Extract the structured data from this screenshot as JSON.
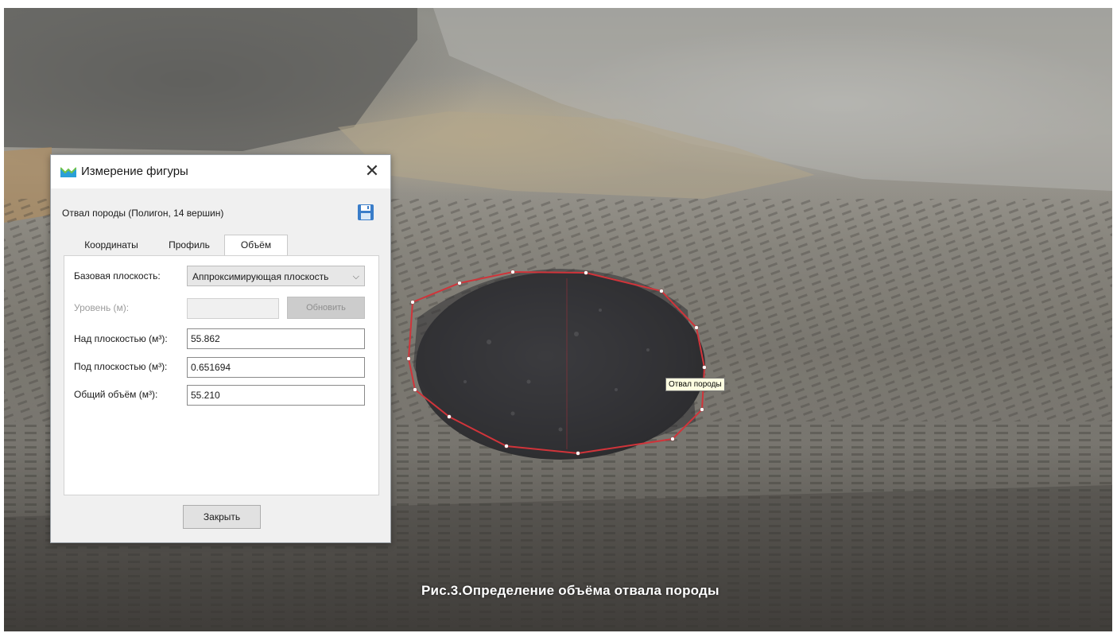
{
  "dialog": {
    "title": "Измерение фигуры",
    "layer_name": "Отвал породы (Полигон, 14 вершин)",
    "tabs": [
      {
        "label": "Координаты"
      },
      {
        "label": "Профиль"
      },
      {
        "label": "Объём"
      }
    ],
    "active_tab": "Объём",
    "base_plane_label": "Базовая плоскость:",
    "base_plane_value": "Аппроксимирующая плоскость",
    "level_label": "Уровень (м):",
    "level_value": "",
    "refresh_label": "Обновить",
    "above_label": "Над плоскостью (м³):",
    "above_value": "55.862",
    "below_label": "Под плоскостью (м³):",
    "below_value": "0.651694",
    "total_label": "Общий объём (м³):",
    "total_value": "55.210",
    "close_label": "Закрыть"
  },
  "map": {
    "tooltip": "Отвал породы",
    "polygon_color": "#d0343a",
    "vertex_color": "#ffffff"
  },
  "caption": "Рис.3.Определение объёма отвала породы",
  "icons": {
    "app": "app-logo-icon",
    "close": "close-icon",
    "save": "save-icon",
    "dropdown": "chevron-down-icon"
  }
}
